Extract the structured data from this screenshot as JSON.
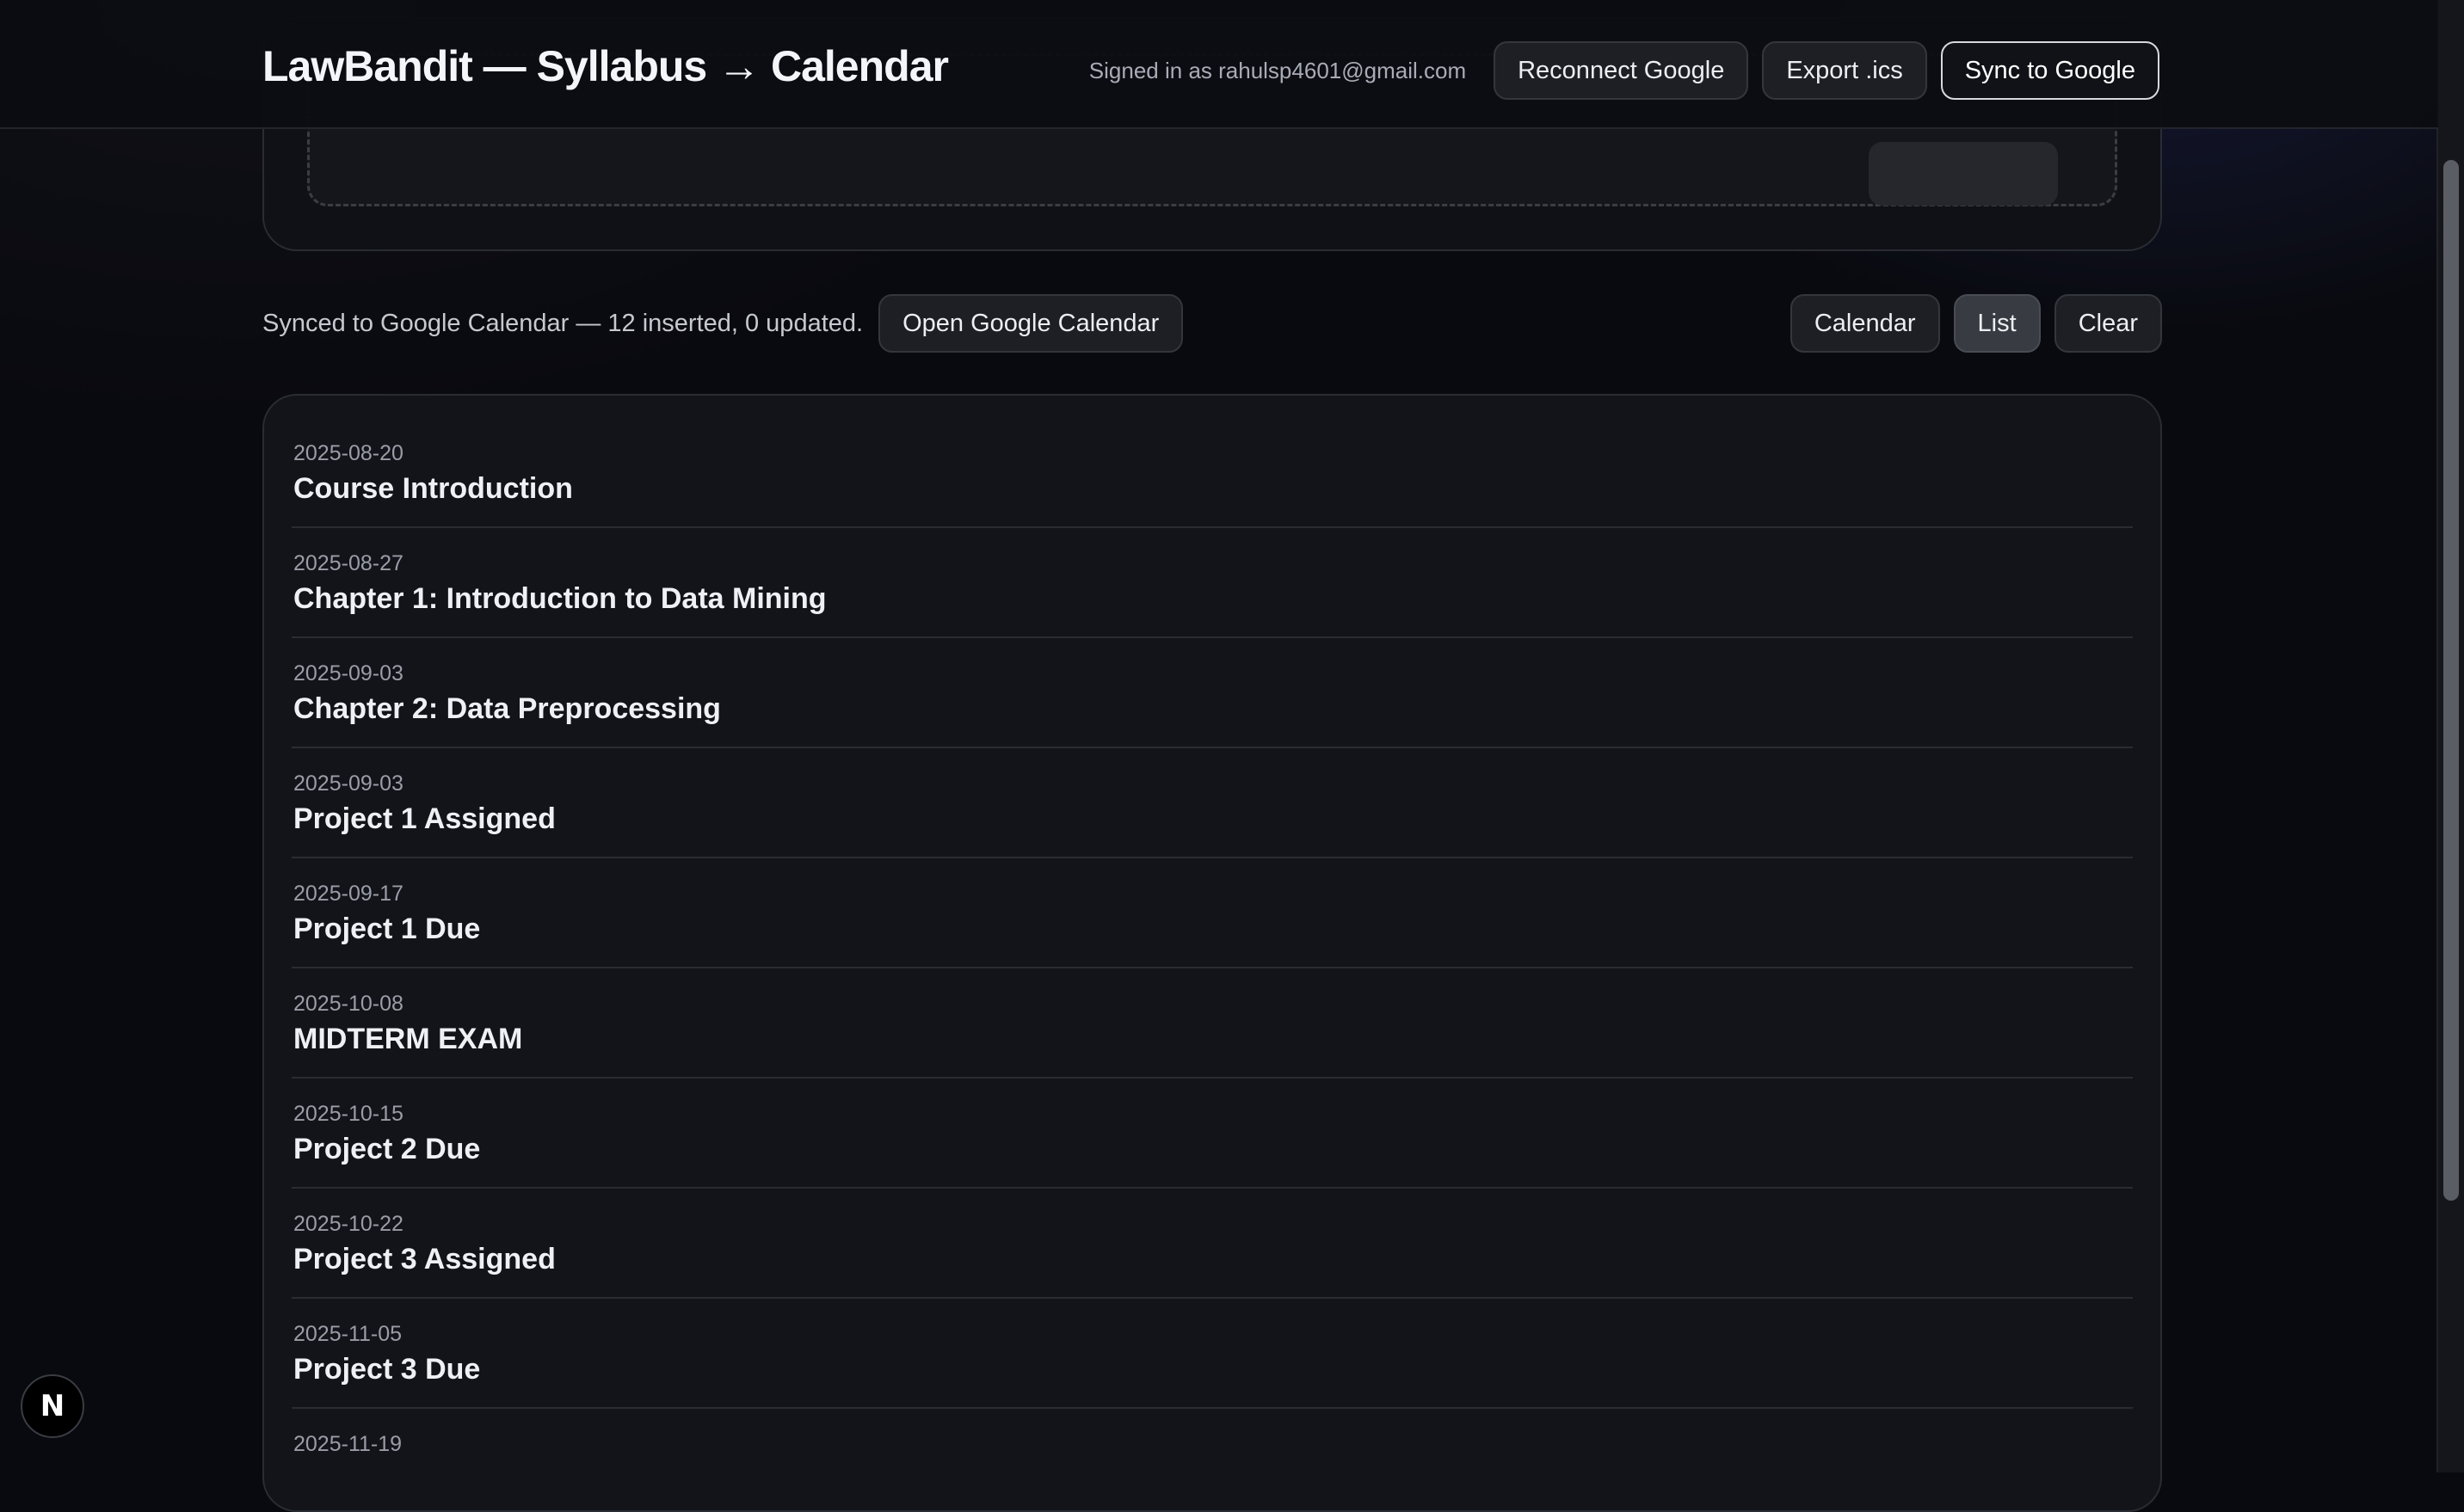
{
  "header": {
    "title": "LawBandit — Syllabus → Calendar",
    "signed_in": "Signed in as rahulsp4601@gmail.com",
    "reconnect_label": "Reconnect Google",
    "export_label": "Export .ics",
    "sync_label": "Sync to Google"
  },
  "status": {
    "message": "Synced to Google Calendar — 12 inserted, 0 updated.",
    "open_calendar_label": "Open Google Calendar"
  },
  "view_toggle": {
    "calendar_label": "Calendar",
    "list_label": "List",
    "clear_label": "Clear",
    "active": "List"
  },
  "events": [
    {
      "date": "2025-08-20",
      "title": "Course Introduction"
    },
    {
      "date": "2025-08-27",
      "title": "Chapter 1: Introduction to Data Mining"
    },
    {
      "date": "2025-09-03",
      "title": "Chapter 2: Data Preprocessing"
    },
    {
      "date": "2025-09-03",
      "title": "Project 1 Assigned"
    },
    {
      "date": "2025-09-17",
      "title": "Project 1 Due"
    },
    {
      "date": "2025-10-08",
      "title": "MIDTERM EXAM"
    },
    {
      "date": "2025-10-15",
      "title": "Project 2 Due"
    },
    {
      "date": "2025-10-22",
      "title": "Project 3 Assigned"
    },
    {
      "date": "2025-11-05",
      "title": "Project 3 Due"
    },
    {
      "date": "2025-11-19",
      "title": ""
    }
  ],
  "badge": {
    "letter": "N",
    "icon": "nextjs-icon"
  },
  "colors": {
    "background": "#090a0f",
    "card": "#131419",
    "border": "#2a2c33",
    "text": "#eef0f4",
    "muted": "#9a9da7"
  }
}
